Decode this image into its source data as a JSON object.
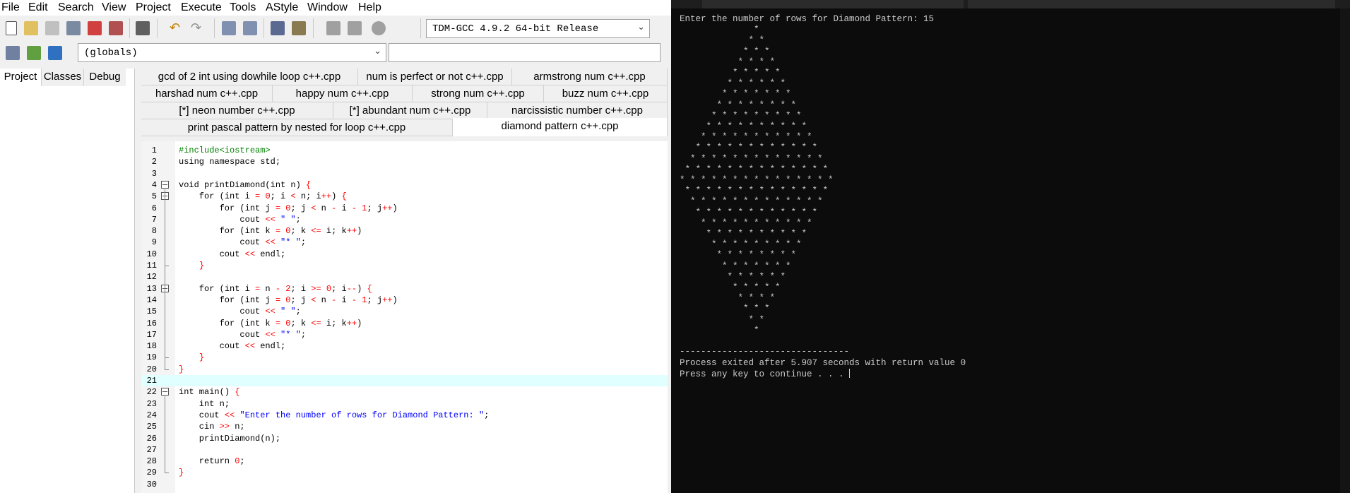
{
  "menu": [
    "File",
    "Edit",
    "Search",
    "View",
    "Project",
    "Execute",
    "Tools",
    "AStyle",
    "Window",
    "Help"
  ],
  "toolbar": {
    "compiler": "TDM-GCC 4.9.2 64-bit Release",
    "scope": "(globals)",
    "member": ""
  },
  "panel_tabs": [
    "Project",
    "Classes",
    "Debug"
  ],
  "file_tabs": {
    "row1": [
      "gcd of 2 int using dowhile loop  c++.cpp",
      "num is perfect or not c++.cpp",
      "armstrong num c++.cpp"
    ],
    "row2": [
      "harshad num c++.cpp",
      "happy num c++.cpp",
      "strong num c++.cpp",
      "buzz num c++.cpp"
    ],
    "row3": [
      "[*] neon number c++.cpp",
      "[*] abundant num c++.cpp",
      "narcissistic number c++.cpp"
    ],
    "row4": [
      "print pascal pattern by nested for loop c++.cpp",
      "diamond pattern c++.cpp"
    ]
  },
  "editor": {
    "current_line": 21,
    "lines": [
      "#include<iostream>",
      "using namespace std;",
      "",
      "void printDiamond(int n) {",
      "    for (int i = 0; i < n; i++) {",
      "        for (int j = 0; j < n - i - 1; j++)",
      "            cout << \" \";",
      "        for (int k = 0; k <= i; k++)",
      "            cout << \"* \";",
      "        cout << endl;",
      "    }",
      "",
      "    for (int i = n - 2; i >= 0; i--) {",
      "        for (int j = 0; j < n - i - 1; j++)",
      "            cout << \" \";",
      "        for (int k = 0; k <= i; k++)",
      "            cout << \"* \";",
      "        cout << endl;",
      "    }",
      "}",
      "",
      "int main() {",
      "    int n;",
      "    cout << \"Enter the number of rows for Diamond Pattern: \";",
      "    cin >> n;",
      "    printDiamond(n);",
      "",
      "    return 0;",
      "}",
      ""
    ]
  },
  "console": {
    "prompt": "Enter the number of rows for Diamond Pattern: 15",
    "rows": 15,
    "separator": "--------------------------------",
    "exit_message": "Process exited after 5.907 seconds with return value 0",
    "continue_message": "Press any key to continue . . . "
  }
}
